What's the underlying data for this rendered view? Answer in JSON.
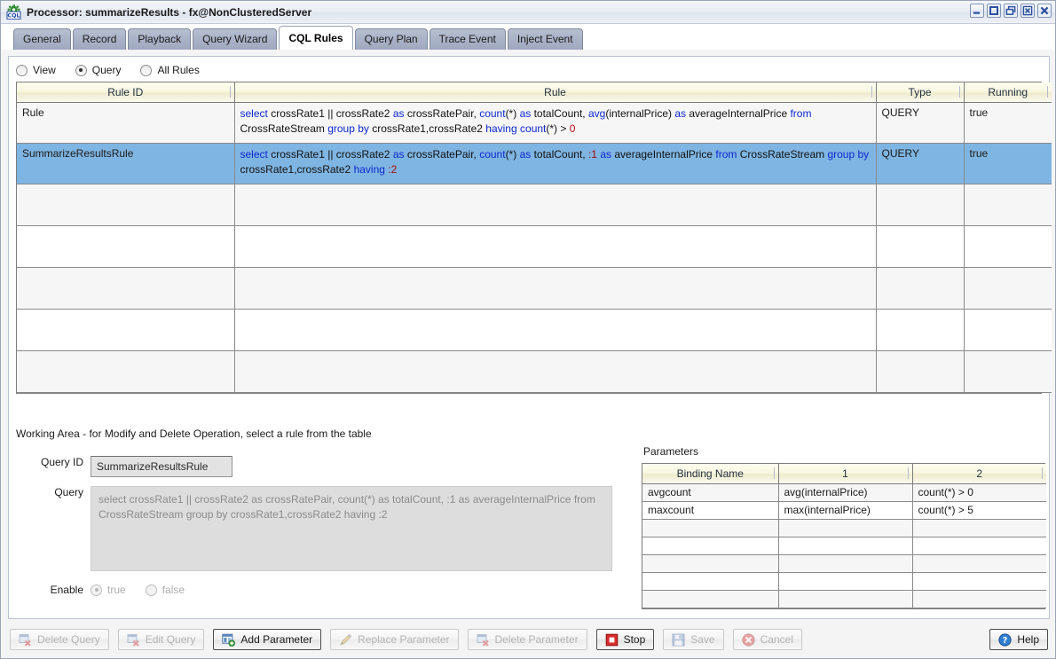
{
  "window": {
    "title": "Processor: summarizeResults - fx@NonClusteredServer",
    "app_icon": "cql-gear-icon",
    "controls": [
      {
        "name": "minimize-button",
        "icon": "minimize-icon"
      },
      {
        "name": "maximize-button",
        "icon": "maximize-icon"
      },
      {
        "name": "restore-button",
        "icon": "restore-icon"
      },
      {
        "name": "close-panel-button",
        "icon": "close-box-icon"
      },
      {
        "name": "close-button",
        "icon": "close-icon"
      }
    ]
  },
  "tabs": [
    {
      "label": "General",
      "active": false
    },
    {
      "label": "Record",
      "active": false
    },
    {
      "label": "Playback",
      "active": false
    },
    {
      "label": "Query Wizard",
      "active": false
    },
    {
      "label": "CQL Rules",
      "active": true
    },
    {
      "label": "Query Plan",
      "active": false
    },
    {
      "label": "Trace Event",
      "active": false
    },
    {
      "label": "Inject Event",
      "active": false
    }
  ],
  "filter_radios": [
    {
      "label": "View",
      "checked": false
    },
    {
      "label": "Query",
      "checked": true
    },
    {
      "label": "All Rules",
      "checked": false
    }
  ],
  "rules_table": {
    "columns": [
      "Rule ID",
      "Rule",
      "Type",
      "Running"
    ],
    "rows": [
      {
        "rule_id": "Rule",
        "type": "QUERY",
        "running": "true",
        "selected": false,
        "query_tokens": [
          {
            "t": "select",
            "c": "kw"
          },
          {
            "t": " crossRate1 || crossRate2 ",
            "c": "txt"
          },
          {
            "t": "as",
            "c": "kw"
          },
          {
            "t": " crossRatePair, ",
            "c": "txt"
          },
          {
            "t": "count",
            "c": "kw"
          },
          {
            "t": "(*) ",
            "c": "txt"
          },
          {
            "t": "as",
            "c": "kw"
          },
          {
            "t": " totalCount, ",
            "c": "txt"
          },
          {
            "t": "avg",
            "c": "kw"
          },
          {
            "t": "(internalPrice) ",
            "c": "txt"
          },
          {
            "t": "as",
            "c": "kw"
          },
          {
            "t": " averageInternalPrice ",
            "c": "txt"
          },
          {
            "t": "from",
            "c": "kw"
          },
          {
            "t": " CrossRateStream ",
            "c": "txt"
          },
          {
            "t": "group by",
            "c": "kw"
          },
          {
            "t": " crossRate1,crossRate2 ",
            "c": "txt"
          },
          {
            "t": "having",
            "c": "kw"
          },
          {
            "t": " ",
            "c": "txt"
          },
          {
            "t": "count",
            "c": "kw"
          },
          {
            "t": "(*) > ",
            "c": "txt"
          },
          {
            "t": "0",
            "c": "num"
          }
        ]
      },
      {
        "rule_id": "SummarizeResultsRule",
        "type": "QUERY",
        "running": "true",
        "selected": true,
        "query_tokens": [
          {
            "t": "select",
            "c": "kw"
          },
          {
            "t": " crossRate1 || crossRate2 ",
            "c": "txt"
          },
          {
            "t": "as",
            "c": "kw"
          },
          {
            "t": " crossRatePair, ",
            "c": "txt"
          },
          {
            "t": "count",
            "c": "kw"
          },
          {
            "t": "(*) ",
            "c": "txt"
          },
          {
            "t": "as",
            "c": "kw"
          },
          {
            "t": " totalCount, ",
            "c": "txt"
          },
          {
            "t": ":1",
            "c": "num"
          },
          {
            "t": " ",
            "c": "txt"
          },
          {
            "t": "as",
            "c": "kw"
          },
          {
            "t": " averageInternalPrice ",
            "c": "txt"
          },
          {
            "t": "from",
            "c": "kw"
          },
          {
            "t": " CrossRateStream ",
            "c": "txt"
          },
          {
            "t": "group by",
            "c": "kw"
          },
          {
            "t": " crossRate1,crossRate2 ",
            "c": "txt"
          },
          {
            "t": "having",
            "c": "kw"
          },
          {
            "t": " ",
            "c": "txt"
          },
          {
            "t": ":2",
            "c": "num"
          }
        ]
      },
      {
        "rule_id": "",
        "type": "",
        "running": "",
        "selected": false,
        "query_tokens": []
      },
      {
        "rule_id": "",
        "type": "",
        "running": "",
        "selected": false,
        "query_tokens": []
      },
      {
        "rule_id": "",
        "type": "",
        "running": "",
        "selected": false,
        "query_tokens": []
      },
      {
        "rule_id": "",
        "type": "",
        "running": "",
        "selected": false,
        "query_tokens": []
      },
      {
        "rule_id": "",
        "type": "",
        "running": "",
        "selected": false,
        "query_tokens": []
      }
    ]
  },
  "working_area": {
    "heading": "Working Area - for Modify and Delete Operation, select a rule from the table",
    "query_id_label": "Query ID",
    "query_id_value": "SummarizeResultsRule",
    "query_label": "Query",
    "query_value": "select crossRate1 || crossRate2 as crossRatePair, count(*) as totalCount, :1 as averageInternalPrice from CrossRateStream group by crossRate1,crossRate2 having :2",
    "enable_label": "Enable",
    "enable_radios": [
      {
        "label": "true",
        "checked": true,
        "disabled": true
      },
      {
        "label": "false",
        "checked": false,
        "disabled": true
      }
    ]
  },
  "parameters": {
    "label": "Parameters",
    "columns": [
      "Binding Name",
      "1",
      "2"
    ],
    "rows": [
      [
        "avgcount",
        "avg(internalPrice)",
        "count(*) > 0"
      ],
      [
        "maxcount",
        "max(internalPrice)",
        "count(*) > 5"
      ],
      [
        "",
        "",
        ""
      ],
      [
        "",
        "",
        ""
      ],
      [
        "",
        "",
        ""
      ],
      [
        "",
        "",
        ""
      ],
      [
        "",
        "",
        ""
      ]
    ]
  },
  "buttons": [
    {
      "label": "Delete Query",
      "icon": "delete-query-icon",
      "enabled": false,
      "name": "delete-query-button"
    },
    {
      "label": "Edit Query",
      "icon": "edit-query-icon",
      "enabled": false,
      "name": "edit-query-button"
    },
    {
      "label": "Add Parameter",
      "icon": "add-parameter-icon",
      "enabled": true,
      "name": "add-parameter-button"
    },
    {
      "label": "Replace Parameter",
      "icon": "pencil-icon",
      "enabled": false,
      "name": "replace-parameter-button"
    },
    {
      "label": "Delete Parameter",
      "icon": "delete-parameter-icon",
      "enabled": false,
      "name": "delete-parameter-button"
    },
    {
      "label": "Stop",
      "icon": "stop-icon",
      "enabled": true,
      "name": "stop-button"
    },
    {
      "label": "Save",
      "icon": "save-icon",
      "enabled": false,
      "name": "save-button"
    },
    {
      "label": "Cancel",
      "icon": "cancel-icon",
      "enabled": false,
      "name": "cancel-button"
    }
  ],
  "help_button": {
    "label": "Help",
    "icon": "help-icon"
  },
  "colors": {
    "selection": "#7fb5e2",
    "header_gradient_top": "#fefeef",
    "header_gradient_bottom": "#eeebcd",
    "keyword": "#0d28d0",
    "number": "#b01010",
    "tab_inactive": "#a9b2c6"
  }
}
